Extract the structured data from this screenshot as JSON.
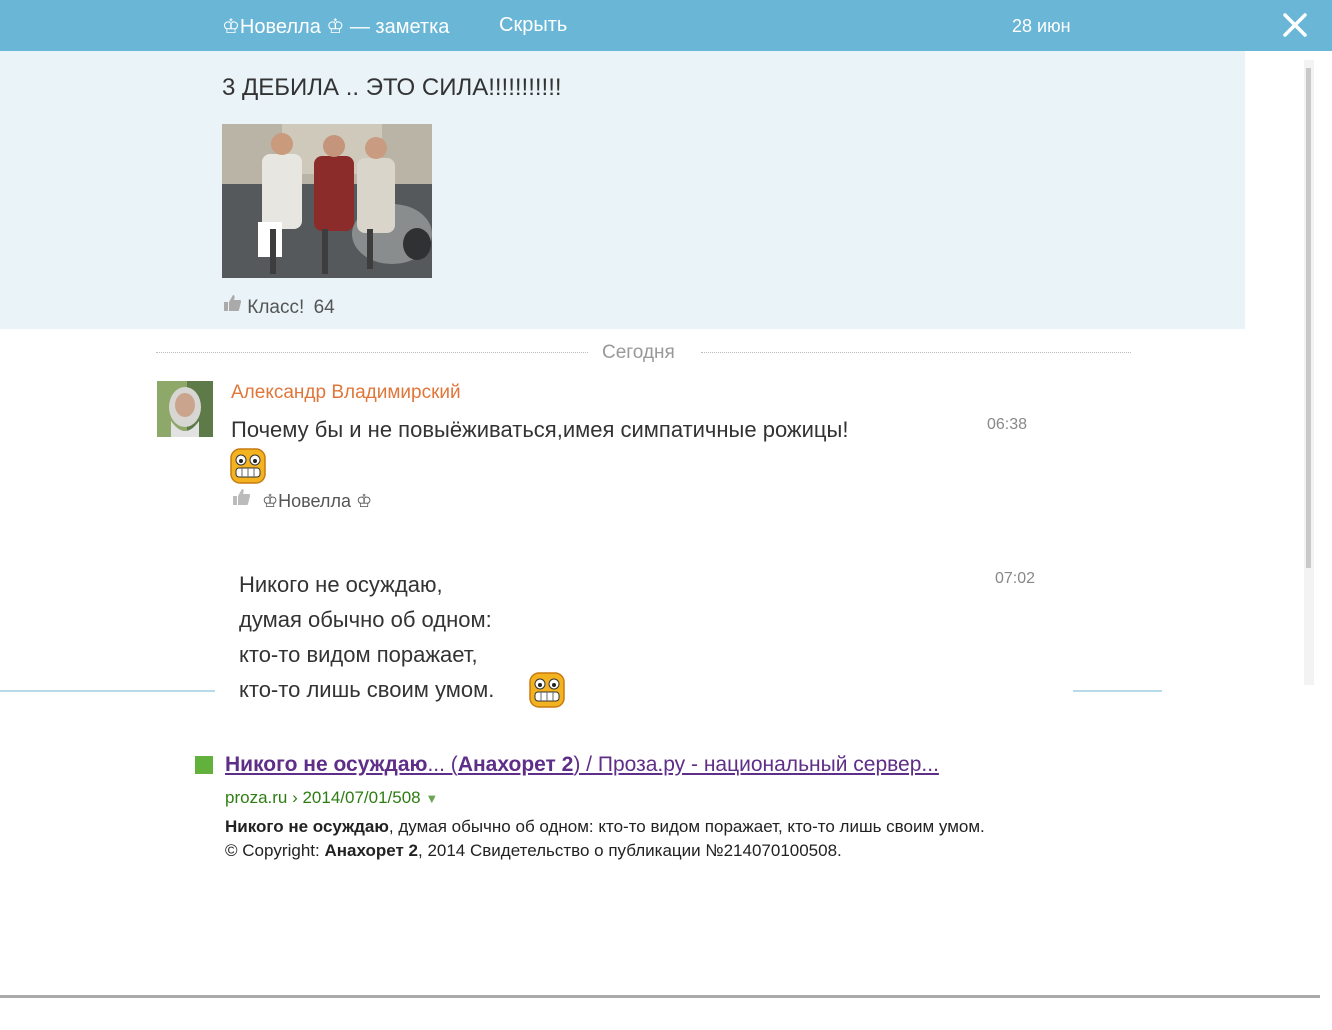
{
  "header": {
    "title": "♔Новелла ♔ — заметка",
    "hide_label": "Скрыть",
    "date": "28 июн"
  },
  "post": {
    "title": "3 ДЕБИЛА .. ЭТО СИЛА!!!!!!!!!!!",
    "likes_label": "Класс!",
    "likes_count": "64"
  },
  "divider_label": "Сегодня",
  "comments": [
    {
      "author": "Александр Владимирский",
      "text": "Почему бы и не повыёживаться,имея симпатичные рожицы!",
      "time": "06:38",
      "liked_by": "♔Новелла ♔"
    },
    {
      "time": "07:02",
      "lines": [
        "Никого не осуждаю,",
        "думая обычно об одном:",
        "кто-то видом поражает,",
        "кто-то лишь своим умом."
      ]
    }
  ],
  "search_result": {
    "title_bold": "Никого не осуждаю",
    "title_mid": "... (",
    "title_author": "Анахорет 2",
    "title_rest": ") / Проза.ру - национальный сервер...",
    "url": "proza.ru › 2014/07/01/508",
    "snippet_bold": "Никого не осуждаю",
    "snippet_1": ", думая обычно об одном: кто-то видом поражает, кто-то лишь своим умом. © Copyright: ",
    "snippet_author": "Анахорет 2",
    "snippet_2": ", 2014 Свидетельство о публикации №214070100508."
  },
  "icons": {
    "close": "close-icon",
    "thumb": "thumbs-up-icon",
    "smiley": "grin-smiley-icon",
    "dropdown": "triangle-down-icon"
  },
  "colors": {
    "topbar": "#6ab6d6",
    "post_bg": "#e9f3f8",
    "author": "#e0763a",
    "visited_link": "#5f2e88",
    "url": "#2e7d13",
    "result_marker": "#61b13c"
  }
}
